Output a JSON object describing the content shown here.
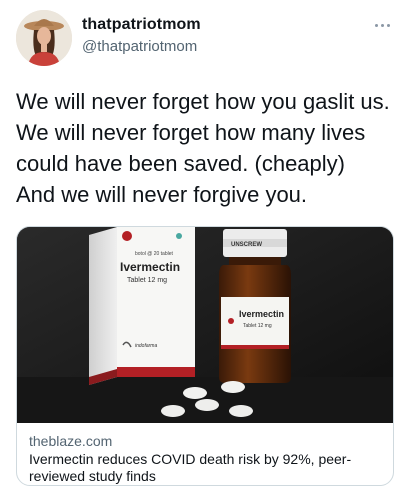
{
  "author": {
    "display_name": "thatpatriotmom",
    "handle": "@thatpatriotmom",
    "avatar_icon": "profile-photo-woman-cowboy-hat-icon"
  },
  "menu": {
    "icon": "more-options-icon"
  },
  "tweet": {
    "lines": [
      "We will never forget how you gaslit us.",
      "We will never forget how many lives",
      "could have been saved. (cheaply)",
      "And we will never forgive you."
    ]
  },
  "link_card": {
    "domain": "theblaze.com",
    "title": "Ivermectin reduces COVID death risk by 92%, peer-reviewed study finds",
    "image": {
      "box_small_text": "botol @ 20 tablet",
      "box_brand": "Ivermectin",
      "box_strength": "Tablet 12 mg",
      "box_maker": "indofarma",
      "bottle_label_brand": "Ivermectin",
      "bottle_label_strength": "Tablet 12 mg",
      "bottle_cap_text": "UNSCREW"
    }
  },
  "colors": {
    "text_primary": "#0f1419",
    "text_secondary": "#536471",
    "card_border": "#cfd9de",
    "brand_red": "#b32025"
  }
}
